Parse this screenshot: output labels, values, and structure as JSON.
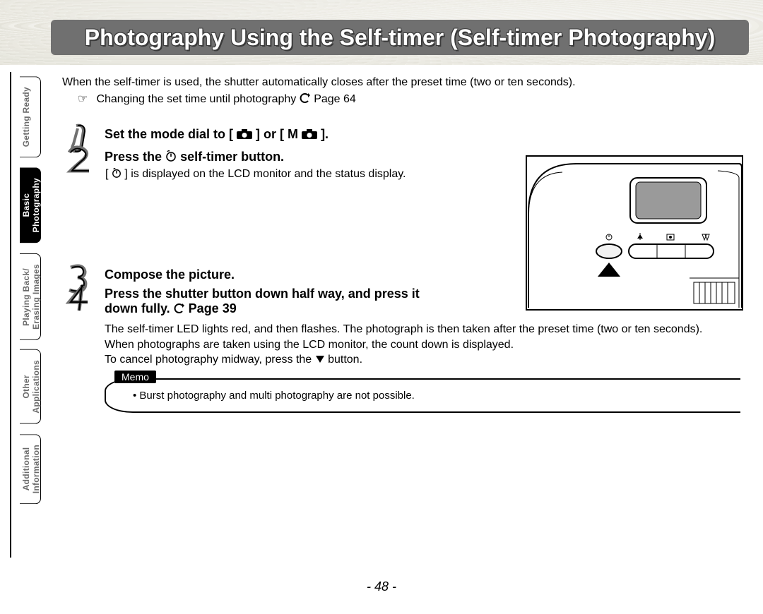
{
  "title": "Photography Using the Self-timer (Self-timer Photography)",
  "tabs": {
    "getting_ready": "Getting Ready",
    "basic_photography": "Basic\nPhotography",
    "playing_back": "Playing Back/\nErasing Images",
    "other_applications": "Other\nApplications",
    "additional_information": "Additional\nInformation"
  },
  "intro": "When the self-timer is used, the shutter automatically closes after the preset time (two or ten seconds).",
  "intro_sub_pre": "Changing the set time until photography ",
  "intro_sub_page": "Page 64",
  "steps": {
    "s1_pre": "Set the mode dial to [ ",
    "s1_mid": " ] or [ M",
    "s1_post": " ].",
    "s2_pre": "Press the ",
    "s2_post": " self-timer button.",
    "s2_note_pre": "[ ",
    "s2_note_post": " ] is displayed on the LCD monitor and the status display.",
    "s3": "Compose the picture.",
    "s4_line1": "Press the shutter button down half way, and press it",
    "s4_line2_pre": "down fully. ",
    "s4_line2_post": "Page 39"
  },
  "desc": {
    "d1": "The self-timer LED lights red, and then flashes. The photograph is then taken after the preset time (two or ten seconds).",
    "d2": "When photographs are taken using the LCD monitor, the count down is displayed.",
    "d3_pre": "To cancel photography midway, press the ",
    "d3_post": " button."
  },
  "memo_label": "Memo",
  "memo_item": "Burst photography and multi photography are not possible.",
  "page_number": "- 48 -"
}
